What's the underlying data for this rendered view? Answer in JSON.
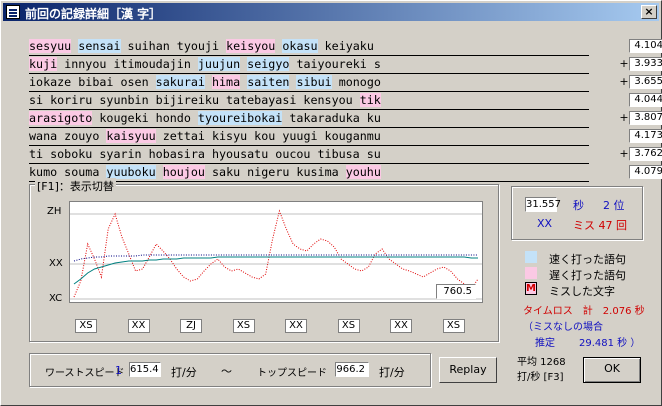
{
  "window": {
    "title": "前回の記録詳細［漢 字］",
    "close_label": "×"
  },
  "rows": [
    {
      "segments": [
        {
          "t": "sesyuu",
          "c": "slow"
        },
        {
          "t": " "
        },
        {
          "t": "sensai",
          "c": "fast"
        },
        {
          "t": " suihan tyouji "
        },
        {
          "t": "keisyou",
          "c": "slow"
        },
        {
          "t": " "
        },
        {
          "t": "okasu",
          "c": "fast"
        },
        {
          "t": " keiyaku"
        }
      ],
      "plus": "",
      "time": "4.104"
    },
    {
      "segments": [
        {
          "t": "kuji",
          "c": "slow"
        },
        {
          "t": " innyou itimoudajin "
        },
        {
          "t": "juujun",
          "c": "fast"
        },
        {
          "t": " "
        },
        {
          "t": "seigyo",
          "c": "fast"
        },
        {
          "t": " taiyoureki s"
        }
      ],
      "plus": "+",
      "time": "3.933"
    },
    {
      "segments": [
        {
          "t": "iokaze bibai osen "
        },
        {
          "t": "sakurai",
          "c": "fast"
        },
        {
          "t": " "
        },
        {
          "t": "hima",
          "c": "slow"
        },
        {
          "t": " "
        },
        {
          "t": "saiten",
          "c": "fast"
        },
        {
          "t": " "
        },
        {
          "t": "sibui",
          "c": "fast"
        },
        {
          "t": " monogo"
        }
      ],
      "plus": "+",
      "time": "3.655"
    },
    {
      "segments": [
        {
          "t": "si koriru syunbin bijireiku tatebayasi kensyou "
        },
        {
          "t": "tik",
          "c": "slow"
        }
      ],
      "plus": "",
      "time": "4.044"
    },
    {
      "segments": [
        {
          "t": "arasigoto",
          "c": "slow"
        },
        {
          "t": " kougeki hondo "
        },
        {
          "t": "tyoureibokai",
          "c": "fast"
        },
        {
          "t": " takaraduka ku"
        }
      ],
      "plus": "+",
      "time": "3.807"
    },
    {
      "segments": [
        {
          "t": "wana zouyo "
        },
        {
          "t": "kaisyuu",
          "c": "slow"
        },
        {
          "t": " zettai kisyu kou yuugi kouganmu"
        }
      ],
      "plus": "",
      "time": "4.173"
    },
    {
      "segments": [
        {
          "t": "ti soboku syarin hobasira hyousatu oucou tibusa su"
        }
      ],
      "plus": "+",
      "time": "3.762"
    },
    {
      "segments": [
        {
          "t": "kumo souma "
        },
        {
          "t": "yuuboku",
          "c": "fast"
        },
        {
          "t": " "
        },
        {
          "t": "houjou",
          "c": "slow"
        },
        {
          "t": " saku nigeru kusima "
        },
        {
          "t": "youhu",
          "c": "slow"
        }
      ],
      "plus": "",
      "time": "4.079"
    }
  ],
  "graph_group": {
    "label": "[F1]：表示切替"
  },
  "chart_data": {
    "type": "line",
    "yticks": [
      "ZH",
      "XX",
      "XC"
    ],
    "value_label": "760.5",
    "xcats": [
      "XS",
      "XX",
      "ZJ",
      "XS",
      "XX",
      "XS",
      "XX",
      "XS"
    ],
    "series": [
      {
        "color": "#e00000",
        "style": "dotted",
        "values": [
          2,
          18,
          55,
          40,
          22,
          70,
          85,
          62,
          45,
          28,
          30,
          42,
          55,
          48,
          40,
          30,
          22,
          18,
          20,
          28,
          35,
          40,
          32,
          28,
          30,
          26,
          22,
          20,
          25,
          60,
          88,
          70,
          55,
          50,
          48,
          55,
          60,
          58,
          52,
          40,
          35,
          30,
          28,
          32,
          45,
          50,
          40,
          35,
          30,
          28,
          25,
          22,
          26,
          30,
          32,
          28,
          20,
          15,
          10,
          20
        ]
      },
      {
        "color": "#008080",
        "style": "solid",
        "values": [
          15,
          20,
          26,
          30,
          32,
          34,
          36,
          37,
          38,
          38,
          38,
          39,
          39,
          40,
          40,
          40,
          41,
          41,
          41,
          41,
          41,
          42,
          42,
          42,
          42,
          42,
          42,
          42,
          42,
          42,
          42,
          42,
          42,
          42,
          42,
          42,
          42,
          42,
          42,
          42,
          42,
          42,
          42,
          42,
          42,
          42,
          42,
          42,
          42,
          42,
          42,
          42,
          42,
          42,
          42,
          42,
          42,
          42,
          41,
          41
        ]
      },
      {
        "color": "#000080",
        "style": "dotted",
        "values": [
          38,
          40,
          41,
          42,
          42,
          43,
          43,
          43,
          43,
          43,
          44,
          44,
          44,
          44,
          44,
          44,
          44,
          44,
          44,
          44,
          44,
          44,
          44,
          44,
          44,
          44,
          44,
          44,
          44,
          44,
          44,
          44,
          44,
          44,
          44,
          44,
          44,
          44,
          44,
          44,
          44,
          44,
          44,
          44,
          44,
          44,
          44,
          44,
          44,
          44,
          44,
          44,
          44,
          44,
          44,
          44,
          44,
          44,
          44,
          44
        ]
      }
    ]
  },
  "result": {
    "time": "31.557",
    "time_unit": "秒",
    "rank": "2 位",
    "class": "XX",
    "miss": "ミス 47 回"
  },
  "legend": [
    {
      "label": "速く打った語句",
      "color": "#c4e2f8"
    },
    {
      "label": "遅く打った語句",
      "color": "#fbc9e4"
    },
    {
      "label": "ミスした文字",
      "mark": "M"
    }
  ],
  "loss": {
    "line1": "タイムロス　計　2.076 秒",
    "line2": "（ミスなしの場合",
    "line3_label": "推定",
    "line3_value": "29.481 秒 ）"
  },
  "speed": {
    "worst_label": "ワーストスピード",
    "worst_num": "1",
    "worst_value": "615.4",
    "unit": "打/分",
    "tilde": "～",
    "top_label": "トップスピード",
    "top_value": "966.2",
    "unit2": "打/分"
  },
  "buttons": {
    "replay": "Replay",
    "ok": "OK"
  },
  "average": {
    "line1": "平均 1268",
    "line2": "打/秒 [F3]"
  },
  "colors": {
    "fast": "#c4e2f8",
    "slow": "#fbc9e4",
    "miss": "#d00000"
  }
}
